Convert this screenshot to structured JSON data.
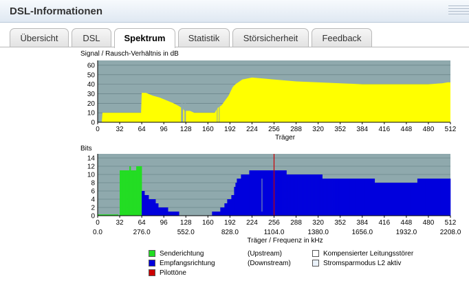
{
  "header": {
    "title": "DSL-Informationen"
  },
  "tabs": [
    {
      "label": "Übersicht",
      "active": false
    },
    {
      "label": "DSL",
      "active": false
    },
    {
      "label": "Spektrum",
      "active": true
    },
    {
      "label": "Statistik",
      "active": false
    },
    {
      "label": "Störsicherheit",
      "active": false
    },
    {
      "label": "Feedback",
      "active": false
    }
  ],
  "snr_chart": {
    "title": "Signal / Rausch-Verhältnis in dB",
    "xlabel": "Träger",
    "x_ticks": [
      "0",
      "32",
      "64",
      "96",
      "128",
      "160",
      "192",
      "224",
      "256",
      "288",
      "320",
      "352",
      "384",
      "416",
      "448",
      "480",
      "512"
    ],
    "y_ticks": [
      "0",
      "10",
      "20",
      "30",
      "40",
      "50",
      "60"
    ]
  },
  "bits_chart": {
    "title": "Bits",
    "xlabel": "Träger / Frequenz in kHz",
    "x_ticks": [
      "0",
      "32",
      "64",
      "96",
      "128",
      "160",
      "192",
      "224",
      "256",
      "288",
      "320",
      "352",
      "384",
      "416",
      "448",
      "480",
      "512"
    ],
    "freq_ticks": [
      "0.0",
      "276.0",
      "552.0",
      "828.0",
      "1104.0",
      "1380.0",
      "1656.0",
      "1932.0",
      "2208.0"
    ],
    "y_ticks": [
      "0",
      "2",
      "4",
      "6",
      "8",
      "10",
      "12",
      "14"
    ]
  },
  "legend": {
    "upstream": {
      "label": "Senderichtung",
      "dir": "(Upstream)",
      "color": "#22dd22"
    },
    "downstream": {
      "label": "Empfangsrichtung",
      "dir": "(Downstream)",
      "color": "#0000dd"
    },
    "pilot": {
      "label": "Pilottöne",
      "color": "#cc0000"
    },
    "compensated": {
      "label": "Kompensierter Leitungsstörer",
      "color": "#ffffff"
    },
    "powersave": {
      "label": "Stromsparmodus L2 aktiv",
      "color": "#eaf2fb"
    }
  },
  "colors": {
    "plot_bg": "#8fa9ad",
    "snr": "#ffff00",
    "upstream": "#22dd22",
    "downstream": "#0000dd",
    "pilot": "#cc0000"
  },
  "chart_data": [
    {
      "type": "area",
      "title": "Signal / Rausch-Verhältnis in dB",
      "xlabel": "Träger",
      "ylabel": "",
      "xlim": [
        0,
        512
      ],
      "ylim": [
        0,
        65
      ],
      "series": [
        {
          "x": [
            0,
            6,
            7,
            63,
            64,
            70,
            80,
            90,
            100,
            110,
            118,
            120,
            124,
            126,
            130,
            134,
            140,
            150,
            160,
            170,
            174,
            180,
            190,
            196,
            200,
            210,
            224,
            240,
            256,
            288,
            320,
            352,
            384,
            416,
            448,
            480,
            500,
            508,
            512
          ],
          "y": [
            0,
            0,
            10,
            10,
            31,
            31,
            28,
            26,
            23,
            20,
            17,
            16,
            14,
            12,
            12,
            12,
            10,
            10,
            10,
            10,
            15,
            18,
            28,
            37,
            40,
            45,
            47,
            46,
            45,
            43,
            42,
            41,
            40,
            40,
            40,
            40,
            41,
            42,
            42
          ]
        }
      ]
    },
    {
      "type": "bar",
      "title": "Bits",
      "xlabel": "Träger / Frequenz in kHz",
      "ylabel": "",
      "xlim": [
        0,
        512
      ],
      "ylim": [
        0,
        15
      ],
      "series": [
        {
          "name": "Senderichtung",
          "x": [
            0,
            31,
            32,
            40,
            45,
            48,
            50,
            56,
            59,
            60,
            64
          ],
          "y": [
            0,
            0,
            11,
            11,
            12,
            11,
            11,
            12,
            12,
            12,
            0
          ]
        },
        {
          "name": "Empfangsrichtung",
          "x": [
            64,
            70,
            76,
            80,
            84,
            90,
            96,
            104,
            112,
            120,
            128,
            160,
            170,
            176,
            180,
            186,
            190,
            196,
            200,
            204,
            210,
            216,
            224,
            236,
            240,
            256,
            288,
            320,
            328,
            352,
            384,
            416,
            448,
            480,
            512
          ],
          "y": [
            6,
            5,
            4,
            4,
            3,
            2,
            2,
            1,
            1,
            0,
            0,
            0,
            1,
            1,
            2,
            3,
            4,
            5,
            8,
            9,
            10,
            10,
            11,
            11,
            11,
            11,
            10,
            10,
            9,
            9,
            9,
            8,
            8,
            9,
            9
          ]
        },
        {
          "name": "Pilottöne",
          "x": [
            256
          ],
          "y": [
            15
          ]
        }
      ]
    }
  ]
}
